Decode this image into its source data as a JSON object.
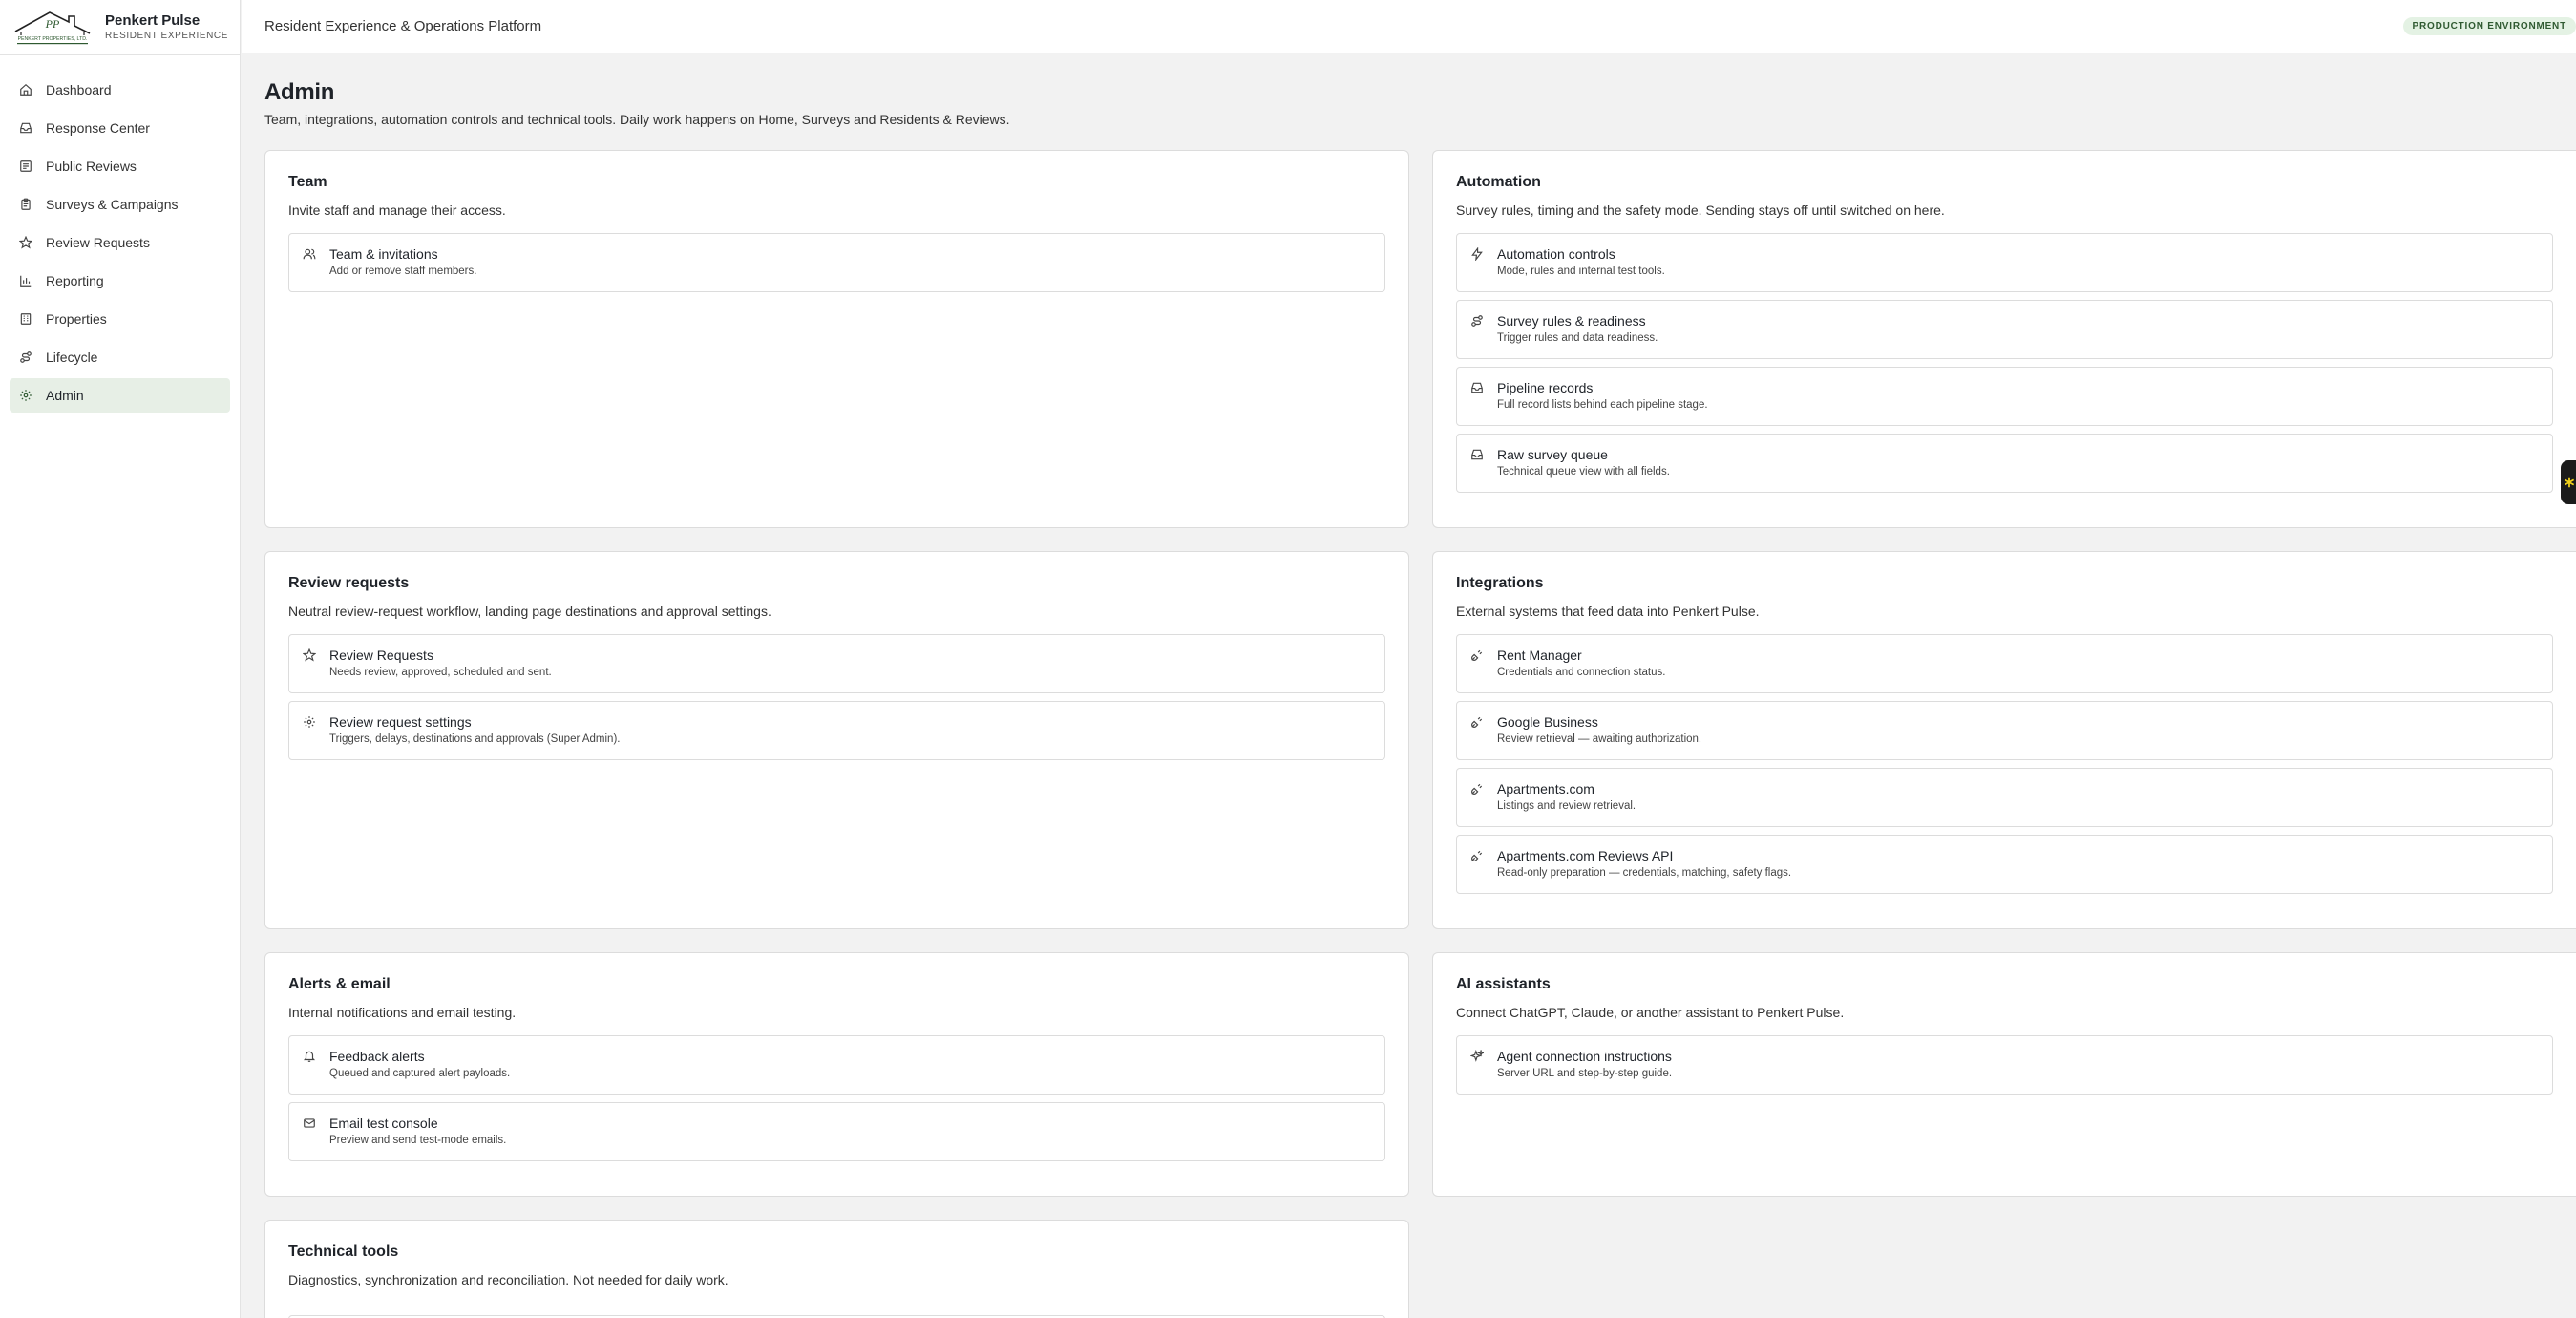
{
  "brand": {
    "logo_text": "PENKERT PROPERTIES, LTD.",
    "name": "Penkert Pulse",
    "subtitle": "RESIDENT EXPERIENCE"
  },
  "topbar": {
    "title": "Resident Experience & Operations Platform",
    "env_badge": "PRODUCTION ENVIRONMENT"
  },
  "nav": [
    {
      "label": "Dashboard",
      "icon": "home-icon"
    },
    {
      "label": "Response Center",
      "icon": "inbox-icon"
    },
    {
      "label": "Public Reviews",
      "icon": "message-square-icon"
    },
    {
      "label": "Surveys & Campaigns",
      "icon": "clipboard-icon"
    },
    {
      "label": "Review Requests",
      "icon": "star-icon"
    },
    {
      "label": "Reporting",
      "icon": "bar-chart-icon"
    },
    {
      "label": "Properties",
      "icon": "building-icon"
    },
    {
      "label": "Lifecycle",
      "icon": "route-icon"
    },
    {
      "label": "Admin",
      "icon": "gear-icon",
      "active": true
    }
  ],
  "page": {
    "title": "Admin",
    "description": "Team, integrations, automation controls and technical tools. Daily work happens on Home, Surveys and Residents & Reviews."
  },
  "cards": {
    "team": {
      "title": "Team",
      "description": "Invite staff and manage their access.",
      "items": [
        {
          "title": "Team & invitations",
          "subtitle": "Add or remove staff members.",
          "icon": "users-icon"
        }
      ]
    },
    "automation": {
      "title": "Automation",
      "description": "Survey rules, timing and the safety mode. Sending stays off until switched on here.",
      "items": [
        {
          "title": "Automation controls",
          "subtitle": "Mode, rules and internal test tools.",
          "icon": "bolt-icon"
        },
        {
          "title": "Survey rules & readiness",
          "subtitle": "Trigger rules and data readiness.",
          "icon": "route-icon"
        },
        {
          "title": "Pipeline records",
          "subtitle": "Full record lists behind each pipeline stage.",
          "icon": "inbox-icon"
        },
        {
          "title": "Raw survey queue",
          "subtitle": "Technical queue view with all fields.",
          "icon": "inbox-icon"
        }
      ]
    },
    "review_requests": {
      "title": "Review requests",
      "description": "Neutral review-request workflow, landing page destinations and approval settings.",
      "items": [
        {
          "title": "Review Requests",
          "subtitle": "Needs review, approved, scheduled and sent.",
          "icon": "star-icon"
        },
        {
          "title": "Review request settings",
          "subtitle": "Triggers, delays, destinations and approvals (Super Admin).",
          "icon": "gear-icon"
        }
      ]
    },
    "integrations": {
      "title": "Integrations",
      "description": "External systems that feed data into Penkert Pulse.",
      "items": [
        {
          "title": "Rent Manager",
          "subtitle": "Credentials and connection status.",
          "icon": "plug-icon"
        },
        {
          "title": "Google Business",
          "subtitle": "Review retrieval — awaiting authorization.",
          "icon": "plug-icon"
        },
        {
          "title": "Apartments.com",
          "subtitle": "Listings and review retrieval.",
          "icon": "plug-icon"
        },
        {
          "title": "Apartments.com Reviews API",
          "subtitle": "Read-only preparation — credentials, matching, safety flags.",
          "icon": "plug-icon"
        }
      ]
    },
    "alerts": {
      "title": "Alerts & email",
      "description": "Internal notifications and email testing.",
      "items": [
        {
          "title": "Feedback alerts",
          "subtitle": "Queued and captured alert payloads.",
          "icon": "bell-icon"
        },
        {
          "title": "Email test console",
          "subtitle": "Preview and send test-mode emails.",
          "icon": "mail-icon"
        }
      ]
    },
    "ai": {
      "title": "AI assistants",
      "description": "Connect ChatGPT, Claude, or another assistant to Penkert Pulse.",
      "items": [
        {
          "title": "Agent connection instructions",
          "subtitle": "Server URL and step-by-step guide.",
          "icon": "sparkles-icon"
        }
      ]
    },
    "technical": {
      "title": "Technical tools",
      "description": "Diagnostics, synchronization and reconciliation. Not needed for daily work."
    }
  },
  "colors": {
    "active_nav": "#e7efe6",
    "badge_bg": "#e4f2e4",
    "badge_text": "#2f5a31",
    "help_tab": "#1b1b1b",
    "help_icon": "#f2d21b"
  }
}
